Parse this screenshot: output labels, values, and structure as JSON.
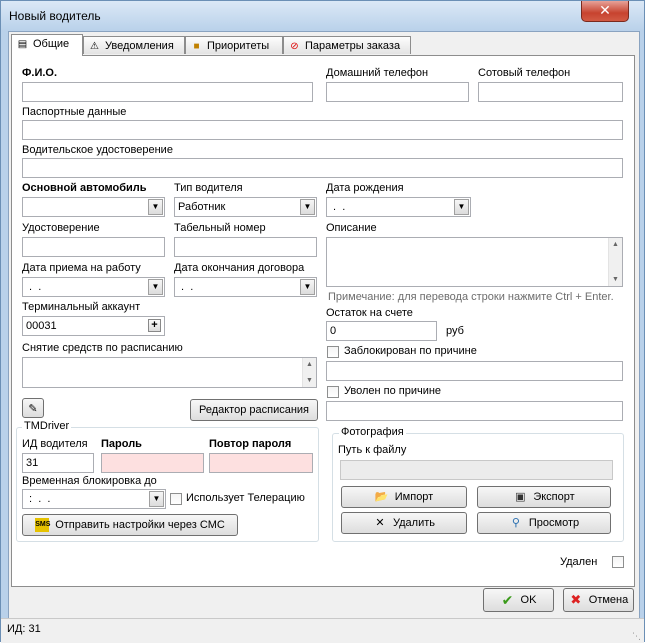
{
  "window": {
    "title": "Новый водитель",
    "close_symbol": "✕"
  },
  "tabs": [
    {
      "label": "Общие",
      "icon": "card-icon",
      "active": true
    },
    {
      "label": "Уведомления",
      "icon": "warning-icon"
    },
    {
      "label": "Приоритеты",
      "icon": "priority-icon"
    },
    {
      "label": "Параметры заказа",
      "icon": "no-smoking-icon"
    }
  ],
  "form": {
    "fio_label": "Ф.И.О.",
    "home_phone_label": "Домашний телефон",
    "cell_phone_label": "Сотовый телефон",
    "passport_label": "Паспортные данные",
    "license_label": "Водительское удостоверение",
    "main_car_label": "Основной автомобиль",
    "driver_type_label": "Тип водителя",
    "driver_type_value": "Работник",
    "birth_date_label": "Дата рождения",
    "birth_date_value": " .  .",
    "certificate_label": "Удостоверение",
    "tab_number_label": "Табельный номер",
    "description_label": "Описание",
    "hire_date_label": "Дата приема на работу",
    "hire_date_value": " .  .",
    "contract_end_label": "Дата окончания договора",
    "contract_end_value": " .  .",
    "description_note": "Примечание: для перевода строки нажмите Ctrl + Enter.",
    "terminal_account_label": "Терминальный аккаунт",
    "terminal_account_value": "00031",
    "balance_label": "Остаток на счете",
    "balance_value": "0",
    "currency": "руб",
    "blocked_label": "Заблокирован по причине",
    "scheduled_withdrawal_label": "Снятие средств по расписанию",
    "fired_label": "Уволен по причине",
    "schedule_editor_button": "Редактор расписания"
  },
  "tmdriver": {
    "group_label": "TMDriver",
    "driver_id_label": "ИД водителя",
    "driver_id_value": "31",
    "password_label": "Пароль",
    "repeat_password_label": "Повтор пароля",
    "temp_block_label": "Временная блокировка до",
    "temp_block_value": " :  .  .",
    "telemetry_label": "Использует Телерацию",
    "send_sms_button": "Отправить настройки через СМС"
  },
  "photo": {
    "group_label": "Фотография",
    "path_label": "Путь к файлу",
    "import_button": "Импорт",
    "export_button": "Экспорт",
    "delete_button": "Удалить",
    "view_button": "Просмотр"
  },
  "deleted_label": "Удален",
  "ok_button": "OK",
  "cancel_button": "Отмена",
  "status_text": "ИД: 31"
}
